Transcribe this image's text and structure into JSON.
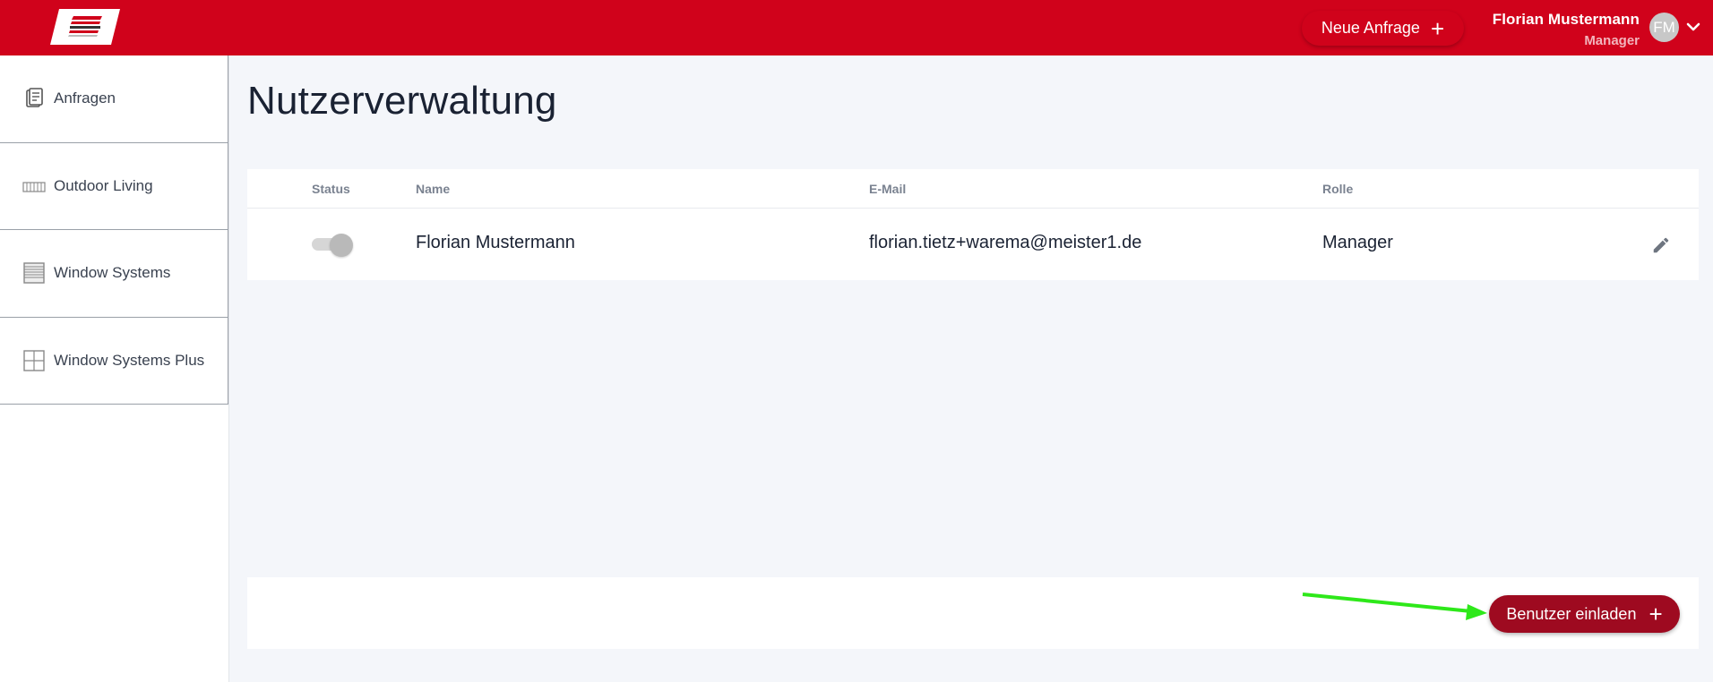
{
  "header": {
    "logo_text": "warema",
    "new_request_label": "Neue Anfrage",
    "user_name": "Florian Mustermann",
    "user_role": "Manager",
    "avatar_initials": "FM",
    "brand_color": "#d0021b"
  },
  "sidebar": {
    "items": [
      {
        "label": "Anfragen",
        "icon": "document-list-icon"
      },
      {
        "label": "Outdoor Living",
        "icon": "pergola-icon"
      },
      {
        "label": "Window Systems",
        "icon": "blind-icon"
      },
      {
        "label": "Window Systems Plus",
        "icon": "window-grid-icon"
      }
    ]
  },
  "main": {
    "title": "Nutzerverwaltung",
    "table": {
      "headers": {
        "status": "Status",
        "name": "Name",
        "email": "E-Mail",
        "role": "Rolle"
      },
      "rows": [
        {
          "status_active": true,
          "name": "Florian Mustermann",
          "email": "florian.tietz+warema@meister1.de",
          "role": "Manager"
        }
      ]
    },
    "invite_label": "Benutzer einladen",
    "invite_color": "#9e0a20",
    "annotation_arrow_color": "#2ee81a"
  }
}
